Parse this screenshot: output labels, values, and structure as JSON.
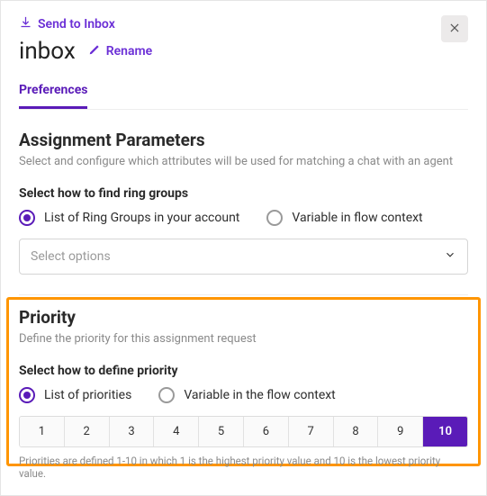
{
  "header": {
    "send_label": "Send to Inbox",
    "title": "inbox",
    "rename_label": "Rename"
  },
  "tabs": {
    "preferences": "Preferences"
  },
  "assignment": {
    "heading": "Assignment Parameters",
    "desc": "Select and configure which attributes will be used for matching a chat with an agent",
    "ring_sub": "Select how to find ring groups",
    "ring_opt1": "List of Ring Groups in your account",
    "ring_opt2": "Variable in flow context",
    "select_placeholder": "Select options"
  },
  "priority": {
    "heading": "Priority",
    "desc": "Define the priority for this assignment request",
    "sub": "Select how to define priority",
    "opt1": "List of priorities",
    "opt2": "Variable in the flow context",
    "values": [
      "1",
      "2",
      "3",
      "4",
      "5",
      "6",
      "7",
      "8",
      "9",
      "10"
    ],
    "selected": "10",
    "footnote": "Priorities are defined 1-10 in which 1 is the highest priority value and 10 is the lowest priority value."
  }
}
